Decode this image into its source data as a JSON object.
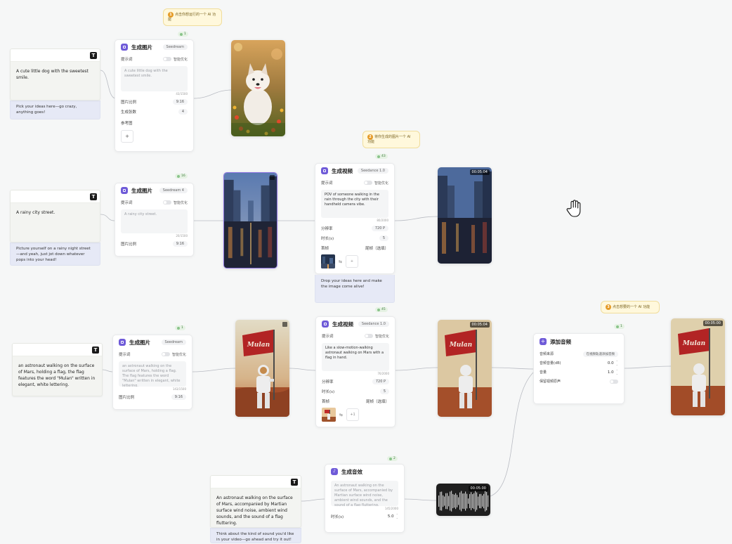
{
  "tips": [
    {
      "num": "1",
      "text": "点击你想运行的一个 AI 功能"
    },
    {
      "num": "2",
      "text": "将你生成的图片一个 AI 功能"
    },
    {
      "num": "3",
      "text": "点击想要的一个 AI 功能"
    }
  ],
  "notes": [
    {
      "text": "A cute little dog with the sweetest smile.",
      "hint": "Pick your ideas here—go crazy, anything goes!"
    },
    {
      "text": "A rainy city street.",
      "hint": "Picture yourself on a rainy night street—and yeah, just jot down whatever pops into your head!"
    },
    {
      "text": "an astronaut walking on the surface of Mars, holding a flag, the flag features the word \"Mulan\" written in elegant, white lettering.",
      "hint": ""
    },
    {
      "text": "An astronaut walking on the surface of Mars, accompanied by Martian surface wind noise, ambient wind sounds, and the sound of a flag fluttering.",
      "hint": "Think about the kind of sound you'd like in your video—go ahead and try it out!"
    }
  ],
  "image_nodes": [
    {
      "title": "生成图片",
      "model": "Seedream",
      "prompt_label": "提示词",
      "toggle_label": "智能优化",
      "prompt": "A cute little dog with the sweetest smile.",
      "counter": "43/1500",
      "rows": [
        {
          "label": "图片比例",
          "value": "9:16"
        },
        {
          "label": "生成张数",
          "value": "4"
        }
      ],
      "ref_label": "参考图",
      "ref_add": "+"
    },
    {
      "title": "生成图片",
      "model": "Seedream 4",
      "prompt_label": "提示词",
      "toggle_label": "智能优化",
      "prompt": "A rainy city street.",
      "counter": "20/1500",
      "rows": [
        {
          "label": "图片比例",
          "value": "9:16"
        }
      ]
    },
    {
      "title": "生成图片",
      "model": "Seedream",
      "prompt_label": "提示词",
      "toggle_label": "智能优化",
      "prompt": "an astronaut walking on the surface of Mars, holding a flag. The flag features the word \"Mulan\" written in elegant, white lettering.",
      "counter": "143/1500",
      "rows": [
        {
          "label": "图片比例",
          "value": "9:16"
        }
      ]
    }
  ],
  "video_nodes": [
    {
      "title": "生成视频",
      "model": "Seedance 1.0",
      "prompt_label": "提示词",
      "toggle_label": "智能优化",
      "prompt": "POV of someone walking in the rain through the city with their handheld camera vibe.",
      "counter": "80/2000",
      "rows": [
        {
          "label": "分辨率",
          "value": "720 P"
        },
        {
          "label": "时长(s)",
          "value": "5"
        }
      ],
      "frame_label": "首帧",
      "frame_label_right": "尾帧（选填）",
      "frame_add": "+",
      "hint": "Drop your ideas here and make the image come alive!"
    },
    {
      "title": "生成视频",
      "model": "Seedance 1.0",
      "prompt_label": "提示词",
      "toggle_label": "智能优化",
      "prompt": "Like a slow-motion-walking astronaut walking on Mars with a flag in hand.",
      "counter": "76/2000",
      "rows": [
        {
          "label": "分辨率",
          "value": "720 P"
        },
        {
          "label": "时长(s)",
          "value": "5"
        }
      ],
      "frame_label": "首帧",
      "frame_label_right": "尾帧（选填）",
      "frame_add": "+1"
    }
  ],
  "sfx_node": {
    "title": "生成音效",
    "prompt": "An astronaut walking on the surface of Mars, accompanied by Martian surface wind noise, ambient wind sounds, and the sound of a flag fluttering.",
    "counter": "145/2000",
    "duration_label": "时长(s)",
    "duration_value": "5.0"
  },
  "audio_tool": {
    "title": "添加音频",
    "rows": [
      {
        "label": "音频来源",
        "value": "在视频轨道添加音频"
      },
      {
        "label": "音频音量(dB)",
        "value": "0.0"
      },
      {
        "label": "音量",
        "value": "1.0"
      },
      {
        "label": "保留视频原声",
        "value": ""
      }
    ]
  },
  "media": {
    "video1_time": "00:05:04",
    "video2_time": "00:05:04",
    "video3_time": "00:05:00",
    "audio_time": "00:05:00",
    "flag_text": "Mulan"
  },
  "chips": [
    "1",
    "16",
    "43",
    "1",
    "45",
    "1",
    "2"
  ],
  "colors": {
    "accent": "#6f5bd8",
    "canvas": "#f6f7f7",
    "tip_bg": "#fff8dc",
    "hint_bg": "#e6e9f6"
  }
}
